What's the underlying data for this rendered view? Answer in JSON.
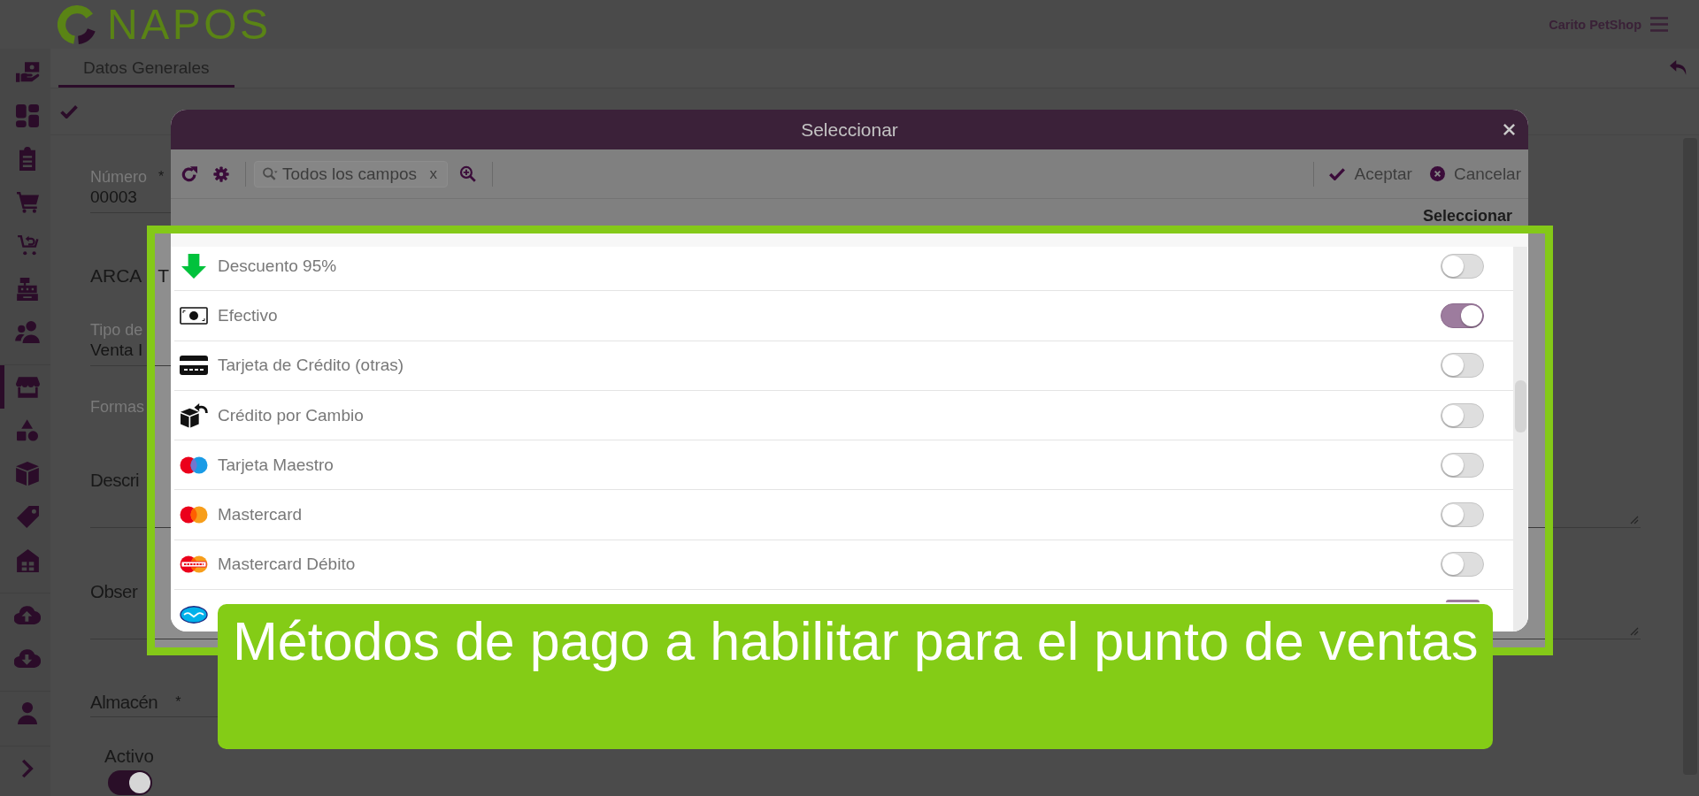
{
  "header": {
    "logo_text": "NAPOS",
    "account": "Carito PetShop"
  },
  "sidebar": {
    "groups": [
      {
        "items": [
          {
            "selected": false
          },
          {
            "selected": false
          },
          {
            "selected": false
          },
          {
            "selected": false
          },
          {
            "selected": false
          },
          {
            "selected": false
          },
          {
            "selected": false
          }
        ]
      },
      {
        "items": [
          {
            "selected": true
          },
          {
            "selected": false
          },
          {
            "selected": false
          },
          {
            "selected": false
          },
          {
            "selected": false
          }
        ]
      },
      {
        "items": [
          {
            "selected": false
          },
          {
            "selected": false
          }
        ]
      },
      {
        "items": [
          {
            "selected": false
          }
        ]
      },
      {
        "items": [
          {
            "selected": false
          }
        ]
      }
    ]
  },
  "tabs": [
    {
      "label": "Datos Generales",
      "selected": true
    }
  ],
  "form": {
    "fields": [
      {
        "kind": "input",
        "label": "Número",
        "required_mark": "*",
        "value": "00003"
      },
      {
        "kind": "section",
        "label": "ARCA",
        "text_2": "T"
      },
      {
        "kind": "input",
        "label": "Tipo de",
        "value": "Venta I"
      },
      {
        "kind": "label",
        "label": "Formas"
      },
      {
        "kind": "textarea",
        "label": "Descri"
      },
      {
        "kind": "textarea",
        "label": "Obser"
      },
      {
        "kind": "select",
        "label": "Almacén",
        "required_mark": "*"
      },
      {
        "kind": "switch",
        "label": "Activo",
        "on": true
      }
    ]
  },
  "dialog": {
    "title": "Seleccionar",
    "search": {
      "filter": "Todos los campos",
      "clear": "x"
    },
    "actions": [
      {
        "kind": "accept",
        "label": "Aceptar"
      },
      {
        "kind": "cancel",
        "label": "Cancelar"
      }
    ],
    "column_header": "Seleccionar",
    "methods": [
      {
        "label": "Descuento 95%",
        "on": false
      },
      {
        "label": "Efectivo",
        "on": true
      },
      {
        "label": "Tarjeta de Crédito (otras)",
        "on": false
      },
      {
        "label": "Crédito por Cambio",
        "on": false
      },
      {
        "label": "Tarjeta Maestro",
        "on": false
      },
      {
        "label": "Mastercard",
        "on": false
      },
      {
        "label": "Mastercard Débito",
        "on": false
      },
      {
        "on": true
      }
    ]
  },
  "caption": "Métodos de pago a habilitar para el punto de ventas"
}
